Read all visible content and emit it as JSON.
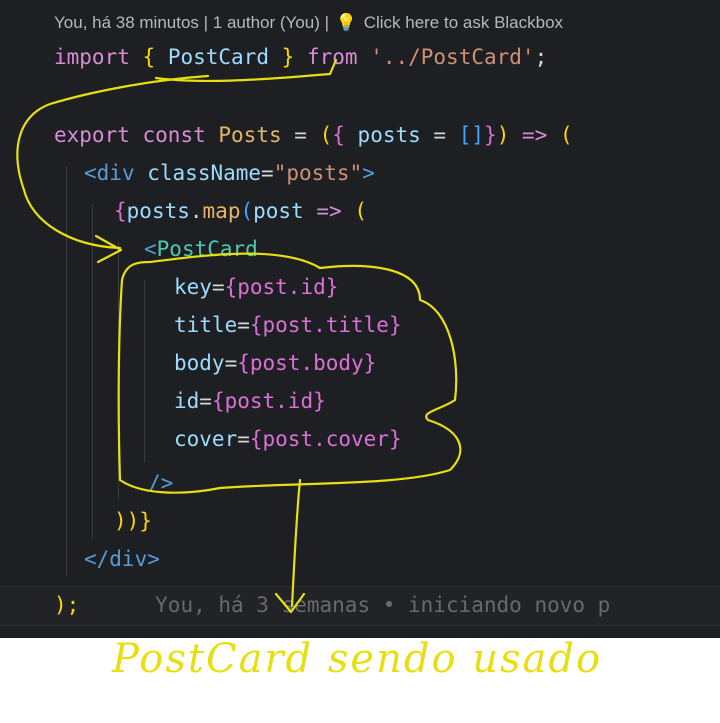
{
  "codelens": {
    "blame": "You, há 38 minutos | 1 author (You) |",
    "bulb_icon": "lightbulb-icon",
    "ask": "Click here to ask Blackbox"
  },
  "code": {
    "l1": {
      "kw": "import",
      "ob": "{",
      "name": "PostCard",
      "cb": "}",
      "from": "from",
      "path": "'../PostCard'",
      "semi": ";"
    },
    "l3": {
      "export": "export",
      "const": "const",
      "name": "Posts",
      "eq": "=",
      "p1": "(",
      "ob": "{",
      "param": "posts",
      "eq2": "=",
      "arr": "[]",
      "cb": "}",
      "p2": ")",
      "arrow": "=>",
      "p3": "("
    },
    "l4": {
      "open": "<",
      "tag": "div",
      "attr": "className",
      "eq": "=",
      "val": "\"posts\"",
      "close": ">"
    },
    "l5": {
      "ob": "{",
      "obj": "posts",
      "dot": ".",
      "method": "map",
      "p1": "(",
      "param": "post",
      "arrow": "=>",
      "p2": "("
    },
    "l6": {
      "open": "<",
      "comp": "PostCard"
    },
    "props": [
      {
        "name": "key",
        "value": "{post.id}"
      },
      {
        "name": "title",
        "value": "{post.title}"
      },
      {
        "name": "body",
        "value": "{post.body}"
      },
      {
        "name": "id",
        "value": "{post.id}"
      },
      {
        "name": "cover",
        "value": "{post.cover}"
      }
    ],
    "l12": "/>",
    "l13": "))}",
    "l14": "</div>",
    "l15": {
      "code": ");",
      "blame": "You, há 3 semanas • iniciando novo p"
    }
  },
  "annotation": {
    "handwriting": "PostCard sendo usado",
    "ink_color": "#e8df12"
  }
}
